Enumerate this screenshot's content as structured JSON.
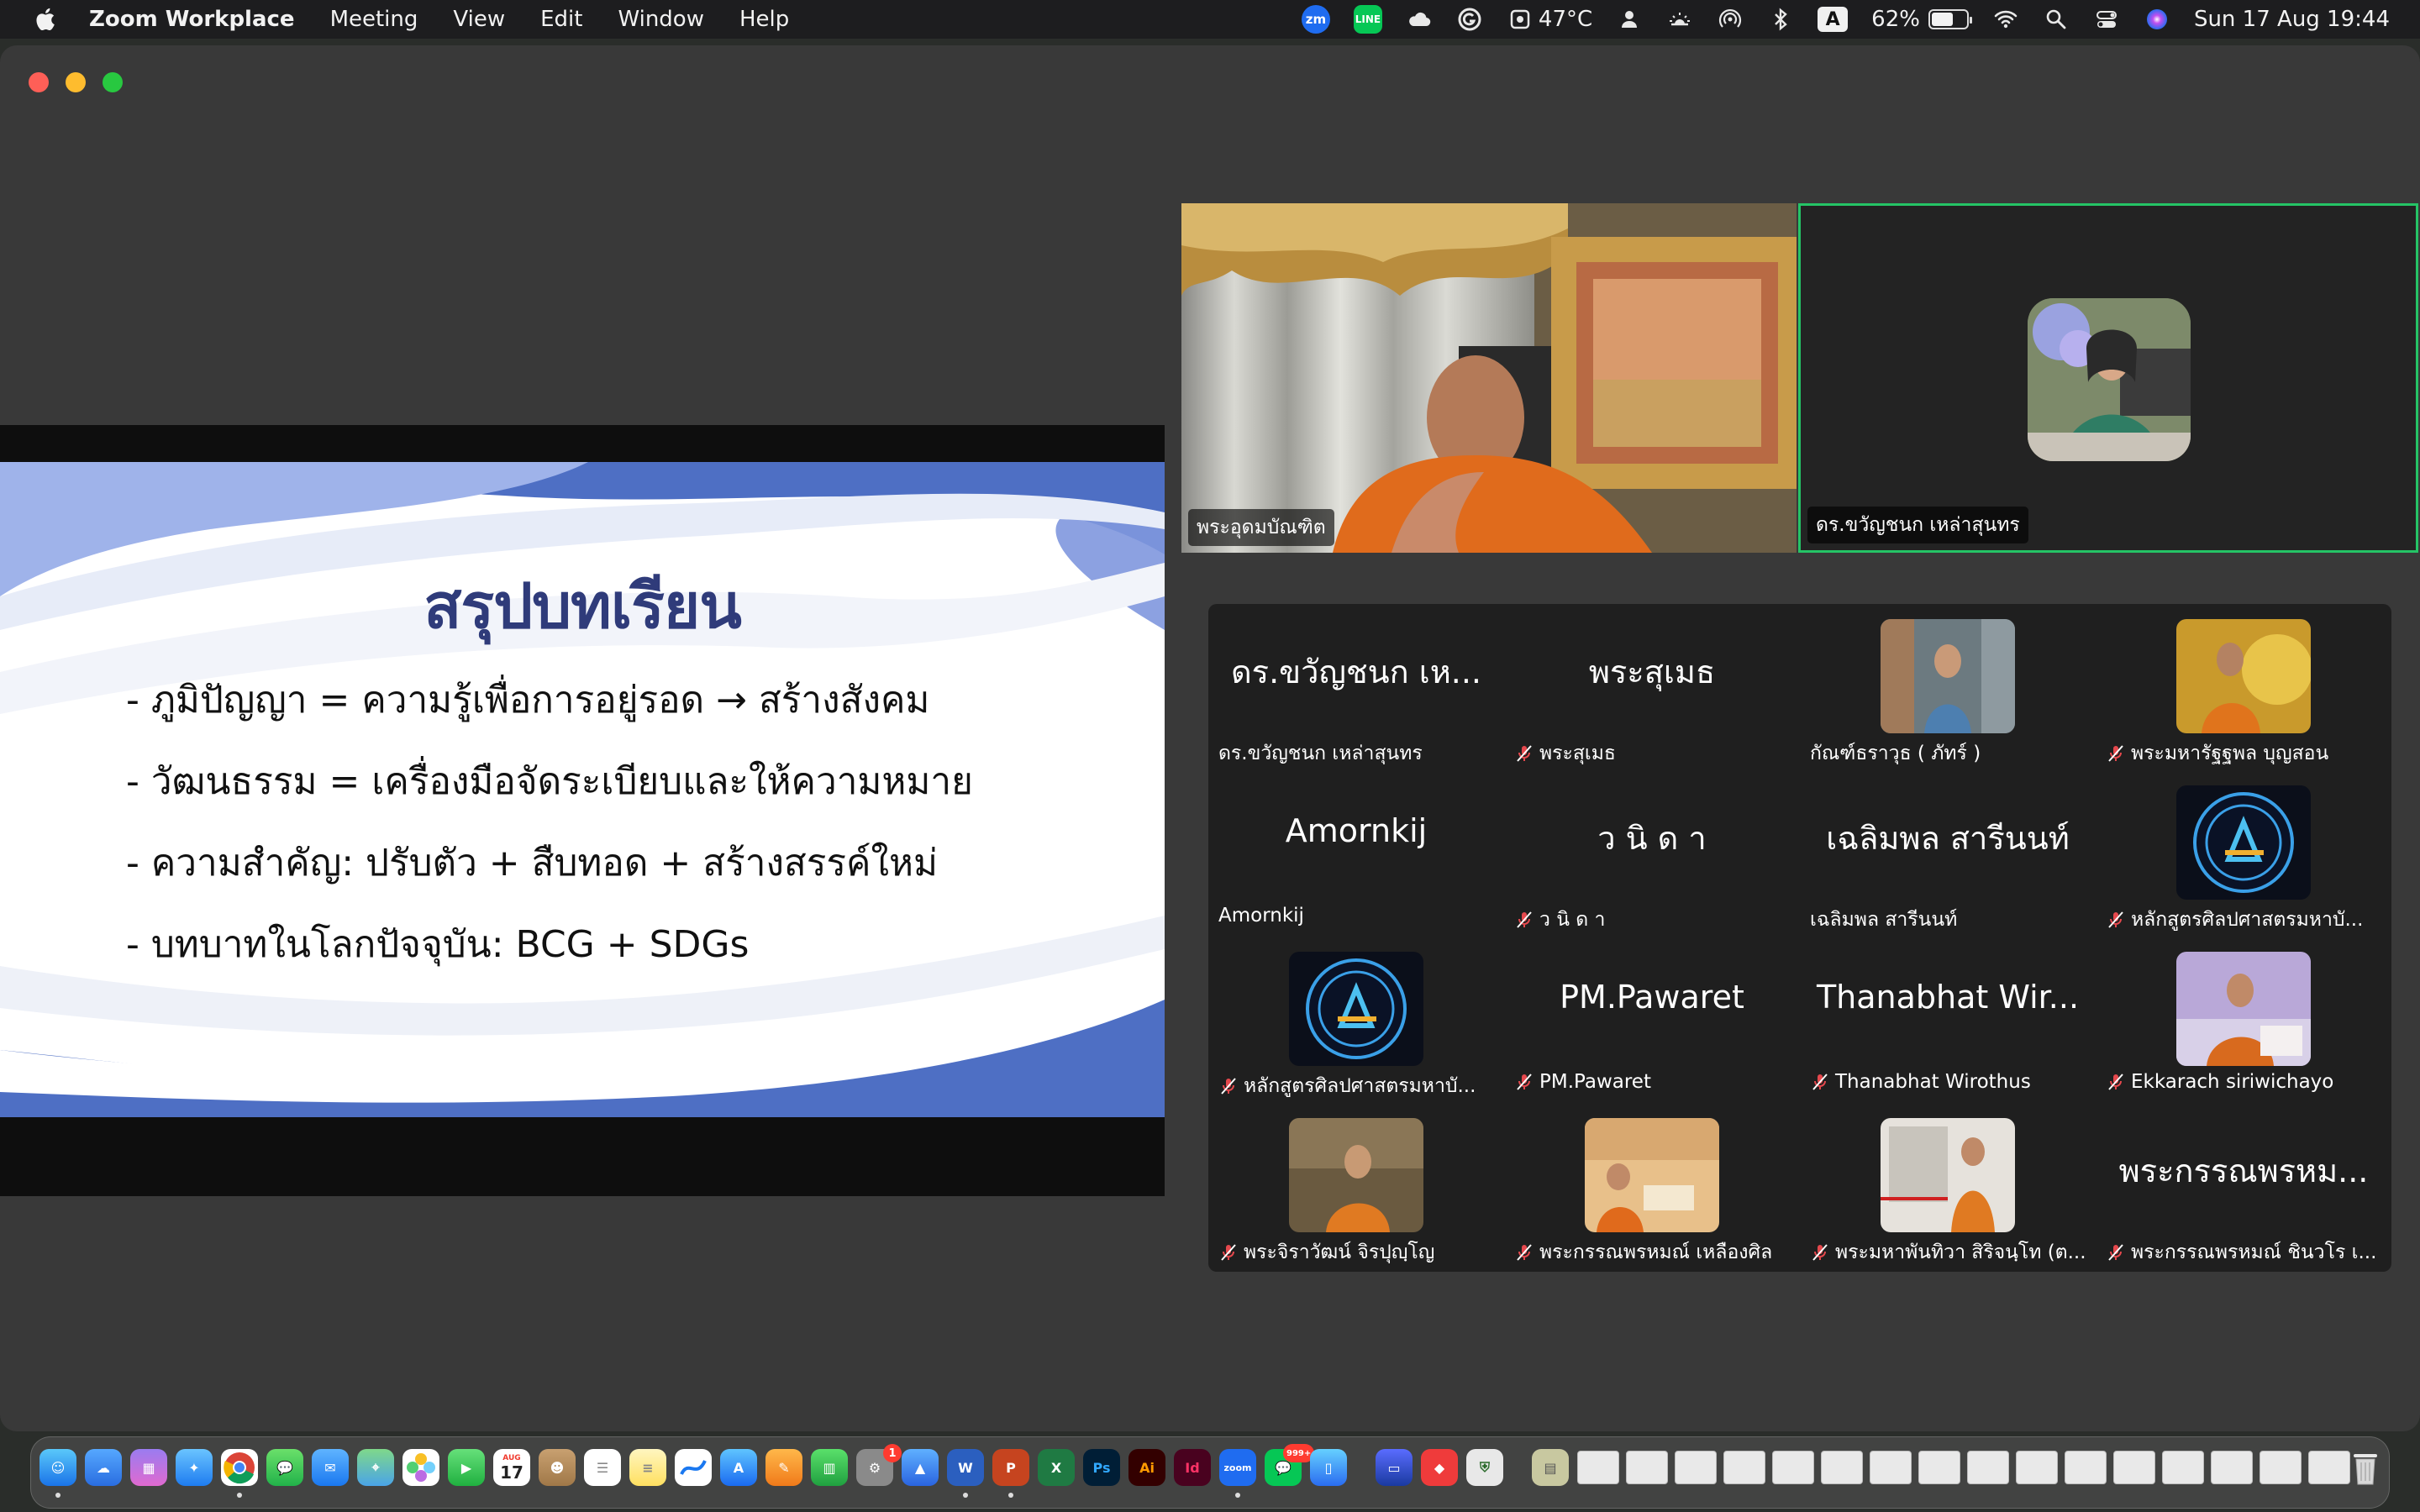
{
  "menubar": {
    "app_name": "Zoom Workplace",
    "menus": [
      "Meeting",
      "View",
      "Edit",
      "Window",
      "Help"
    ],
    "zoom_status_badge": "zm",
    "line_badge": "LINE",
    "temperature": "47°C",
    "input_source": "A",
    "battery_percent": "62%",
    "battery_level": 0.62,
    "datetime": "Sun 17 Aug  19:44"
  },
  "slide": {
    "title": "สรุปบทเรียน",
    "bullets": [
      "- ภูมิปัญญา = ความรู้เพื่อการอยู่รอด → สร้างสังคม",
      "- วัฒนธรรม = เครื่องมือจัดระเบียบและให้ความหมาย",
      "- ความสำคัญ: ปรับตัว + สืบทอด + สร้างสรรค์ใหม่",
      "- บทบาทในโลกปัจจุบัน: BCG + SDGs"
    ]
  },
  "videos": {
    "host_name": "พระอุดมบัณฑิต",
    "speaker_name": "ดร.ขวัญชนก เหล่าสุนทร"
  },
  "gallery": [
    {
      "big": "ดร.ขวัญชนก เห...",
      "label": "ดร.ขวัญชนก เหล่าสุนทร",
      "muted": false
    },
    {
      "big": "พระสุเมธ",
      "label": "พระสุเมธ",
      "muted": true
    },
    {
      "big": "",
      "label": "กัณฑ์ธราวุธ ( ภัทร์ )",
      "muted": false
    },
    {
      "big": "",
      "label": "พระมหารัฐฐพล บุญสอน",
      "muted": true
    },
    {
      "big": "Amornkij",
      "label": "Amornkij",
      "muted": false
    },
    {
      "big": "ว นิ ด า",
      "label": "ว นิ ด า",
      "muted": true
    },
    {
      "big": "เฉลิมพล สารีนนท์",
      "label": "เฉลิมพล สารีนนท์",
      "muted": false
    },
    {
      "big": "",
      "label": "หลักสูตรศิลปศาสตรมหาบั...",
      "muted": true
    },
    {
      "big": "",
      "label": "หลักสูตรศิลปศาสตรมหาบั...",
      "muted": true
    },
    {
      "big": "PM.Pawaret",
      "label": "PM.Pawaret",
      "muted": true
    },
    {
      "big": "Thanabhat Wir...",
      "label": "Thanabhat Wirothus",
      "muted": true
    },
    {
      "big": "",
      "label": "Ekkarach siriwichayo",
      "muted": true
    },
    {
      "big": "",
      "label": "พระจิราวัฒน์ จิรปุญฺโญ",
      "muted": true
    },
    {
      "big": "",
      "label": "พระกรรณพรหมณ์ เหลืองศิล",
      "muted": true
    },
    {
      "big": "",
      "label": "พระมหาพันทิวา สิริจนฺโท (ต...",
      "muted": true
    },
    {
      "big": "พระกรรณพรหม...",
      "label": "พระกรรณพรหมณ์ ชินวโร เ...",
      "muted": true
    }
  ],
  "dock": {
    "calendar_month": "AUG",
    "calendar_day": "17",
    "messages_badge": "1",
    "line_badge": "999+",
    "app_labels": {
      "ps": "Ps",
      "ai": "Ai",
      "id": "Id",
      "word": "W",
      "powerpoint": "P",
      "excel": "X",
      "zoom": "zoom"
    }
  },
  "colors": {
    "slide_title": "#2f3b7a",
    "slide_wave": "#4e6fc4",
    "active_speaker_border": "#25c466",
    "mic_muted": "#e5484d"
  }
}
